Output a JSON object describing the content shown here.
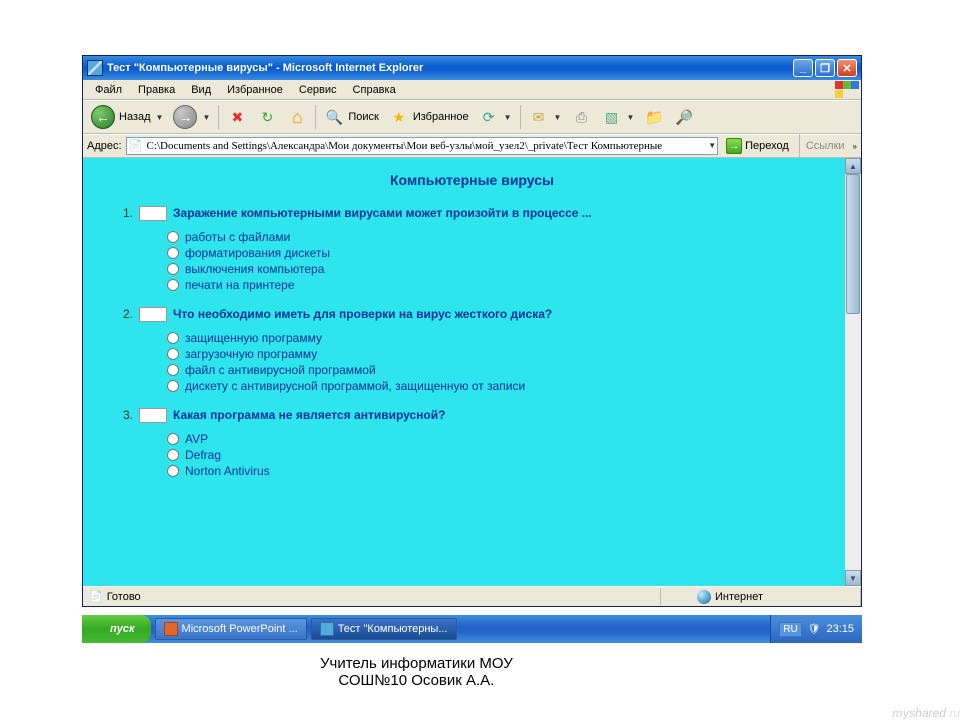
{
  "window": {
    "title": "Тест \"Компьютерные вирусы\" - Microsoft Internet Explorer",
    "minimize": "_",
    "maximize": "❐",
    "close": "✕"
  },
  "menu": {
    "file": "Файл",
    "edit": "Правка",
    "view": "Вид",
    "favorites": "Избранное",
    "tools": "Сервис",
    "help": "Справка"
  },
  "toolbar": {
    "back": "Назад",
    "back_arrow": "←",
    "fwd_arrow": "→",
    "stop": "✖",
    "refresh": "↻",
    "home": "⌂",
    "search": "Поиск",
    "favorites": "Избранное",
    "fav_star": "★",
    "search_icon": "🔍",
    "media_icon": "⟳",
    "mail_icon": "✉",
    "print_icon": "⎙",
    "edit_icon": "▧",
    "discuss_icon": "📁",
    "related_icon": "🔎"
  },
  "address": {
    "label": "Адрес:",
    "value": "C:\\Documents and Settings\\Александра\\Мои документы\\Мои веб-узлы\\мой_узел2\\_private\\Тест Компьютерные",
    "go": "Переход",
    "links": "Ссылки"
  },
  "page": {
    "title": "Компьютерные вирусы",
    "questions": [
      {
        "num": "1.",
        "text": "Заражение компьютерными вирусами может произойти в процессе ...",
        "options": [
          "работы с файлами",
          "форматирования дискеты",
          "выключения компьютера",
          "печати на принтере"
        ]
      },
      {
        "num": "2.",
        "text": "Что необходимо иметь для проверки на вирус жесткого диска?",
        "options": [
          "защищенную программу",
          "загрузочную программу",
          "файл с антивирусной программой",
          "дискету с антивирусной программой, защищенную от записи"
        ]
      },
      {
        "num": "3.",
        "text": "Какая программа не является антивирусной?",
        "options": [
          "AVP",
          "Defrag",
          "Norton Antivirus"
        ]
      }
    ]
  },
  "status": {
    "ready": "Готово",
    "zone": "Интернет"
  },
  "taskbar": {
    "start": "пуск",
    "item1": "Microsoft PowerPoint ...",
    "item2": "Тест \"Компьютерны...",
    "lang": "RU",
    "time": "23:15"
  },
  "caption": {
    "line1": "Учитель информатики МОУ",
    "line2": "СОШ№10 Осовик А.А."
  },
  "watermark": "myshared"
}
